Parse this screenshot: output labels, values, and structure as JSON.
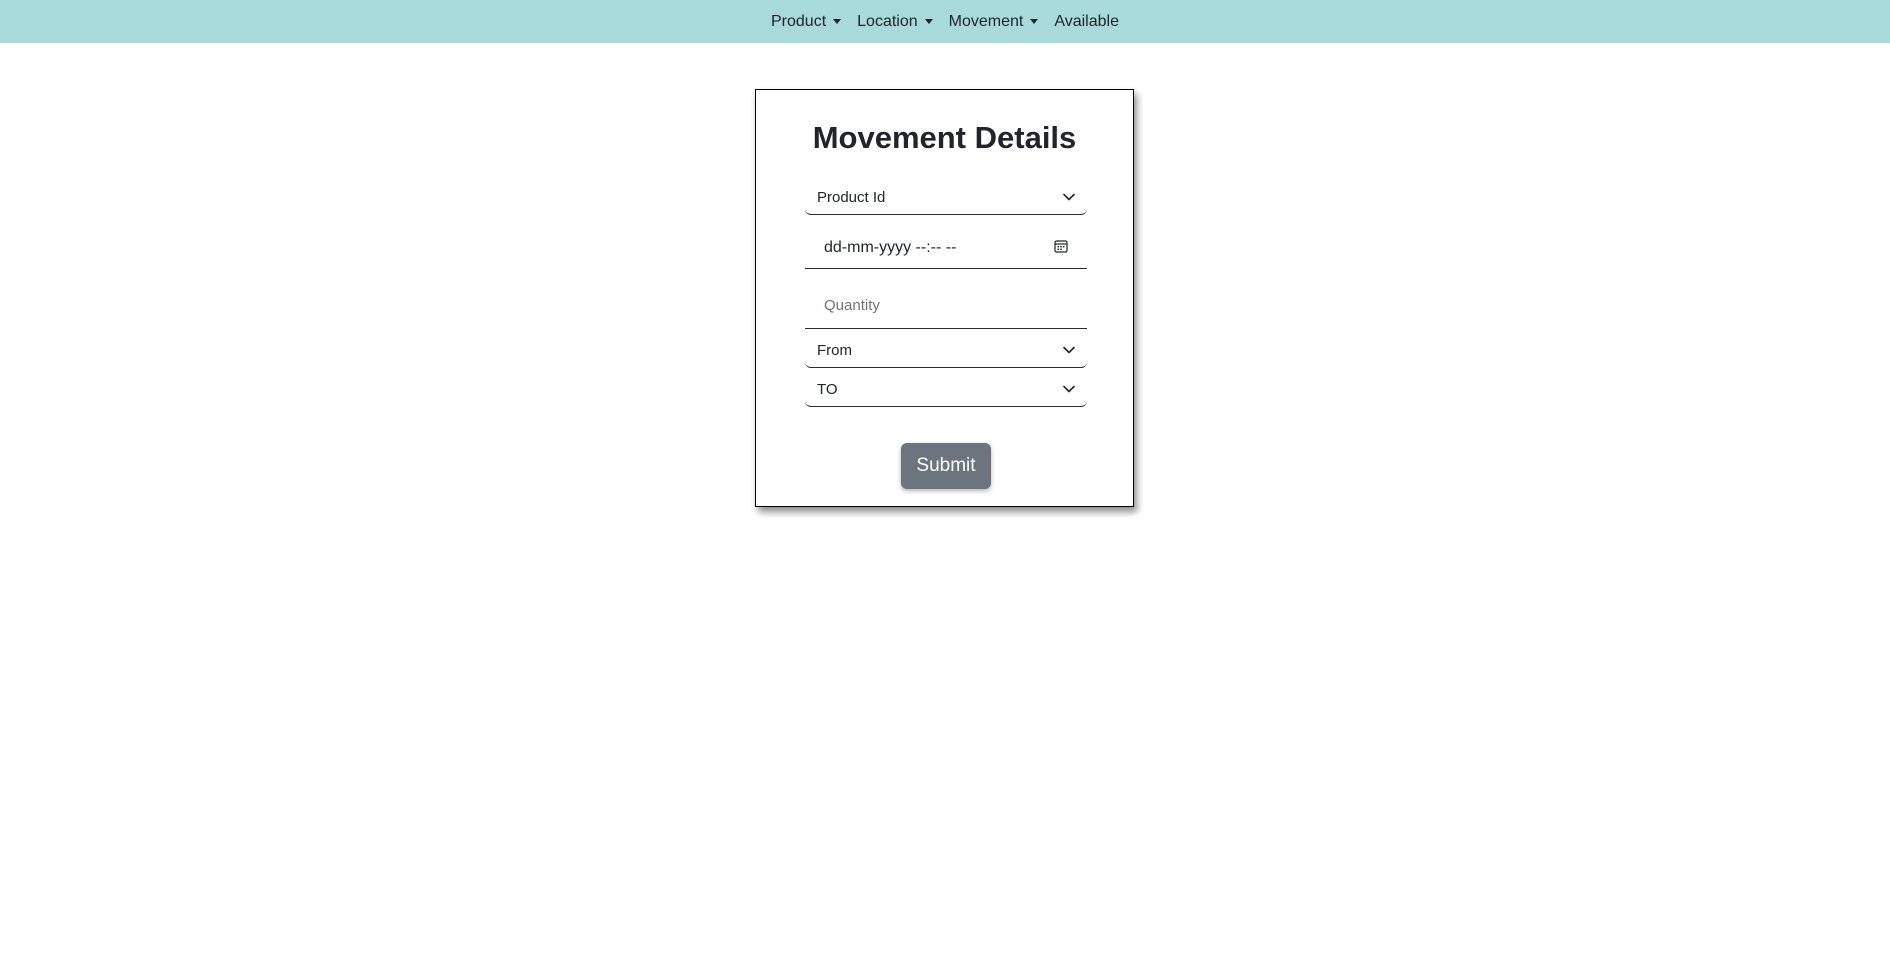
{
  "nav": {
    "items": [
      {
        "label": "Product",
        "dropdown": true
      },
      {
        "label": "Location",
        "dropdown": true
      },
      {
        "label": "Movement",
        "dropdown": true
      },
      {
        "label": "Available",
        "dropdown": false
      }
    ]
  },
  "form": {
    "title": "Movement Details",
    "product_select": {
      "value": "Product Id",
      "icon": "chevron-down-icon"
    },
    "datetime": {
      "value": "dd-mm-yyyy --:-- --",
      "icon": "calendar-icon"
    },
    "quantity": {
      "placeholder": "Quantity"
    },
    "from_select": {
      "value": "From",
      "icon": "chevron-down-icon"
    },
    "to_select": {
      "value": "TO",
      "icon": "chevron-down-icon"
    },
    "submit_label": "Submit"
  },
  "colors": {
    "navbar": "#a8dadc",
    "button": "#6c757d"
  }
}
